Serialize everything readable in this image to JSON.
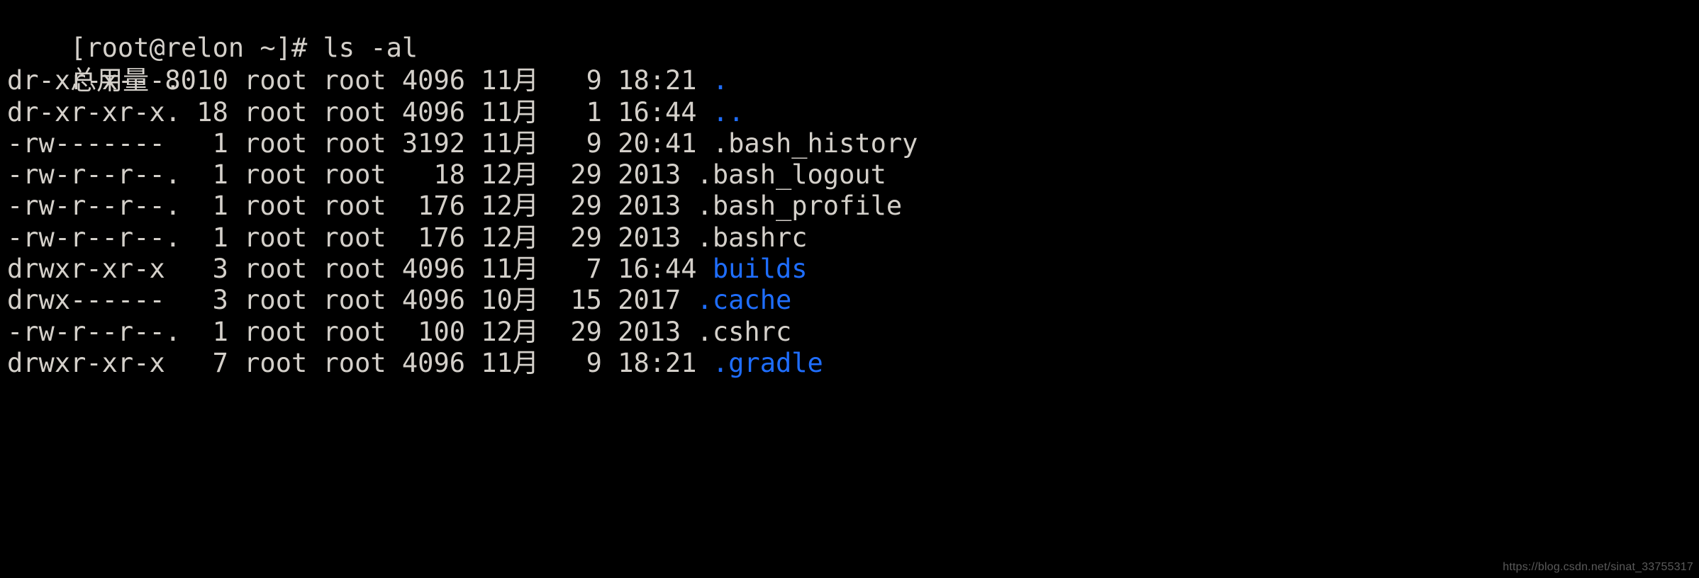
{
  "terminal": {
    "background_color": "#000000",
    "foreground_color": "#d4d0ca",
    "directory_color": "#1f6eff",
    "prompt": {
      "full_line": "[root@relon ~]# ls -al",
      "user_host": "[root@relon ~]#",
      "command": "ls -al"
    },
    "total_line": "总用量 80",
    "columns": [
      "permissions",
      "links",
      "owner",
      "group",
      "size",
      "month",
      "day",
      "time_or_year",
      "name"
    ],
    "entries": [
      {
        "permissions": "dr-xr-x---.",
        "links": "10",
        "owner": "root",
        "group": "root",
        "size": "4096",
        "month": "11月",
        "day": "9",
        "time_or_year": "18:21",
        "name": ".",
        "type": "directory",
        "line": "dr-xr-x---. 10 root root 4096 11月   9 18:21 "
      },
      {
        "permissions": "dr-xr-xr-x.",
        "links": "18",
        "owner": "root",
        "group": "root",
        "size": "4096",
        "month": "11月",
        "day": "1",
        "time_or_year": "16:44",
        "name": "..",
        "type": "directory",
        "line": "dr-xr-xr-x. 18 root root 4096 11月   1 16:44 "
      },
      {
        "permissions": "-rw-------",
        "links": "1",
        "owner": "root",
        "group": "root",
        "size": "3192",
        "month": "11月",
        "day": "9",
        "time_or_year": "20:41",
        "name": ".bash_history",
        "type": "file",
        "line": "-rw-------   1 root root 3192 11月   9 20:41 "
      },
      {
        "permissions": "-rw-r--r--.",
        "links": "1",
        "owner": "root",
        "group": "root",
        "size": "18",
        "month": "12月",
        "day": "29",
        "time_or_year": "2013",
        "name": ".bash_logout",
        "type": "file",
        "line": "-rw-r--r--.  1 root root   18 12月  29 2013 "
      },
      {
        "permissions": "-rw-r--r--.",
        "links": "1",
        "owner": "root",
        "group": "root",
        "size": "176",
        "month": "12月",
        "day": "29",
        "time_or_year": "2013",
        "name": ".bash_profile",
        "type": "file",
        "line": "-rw-r--r--.  1 root root  176 12月  29 2013 "
      },
      {
        "permissions": "-rw-r--r--.",
        "links": "1",
        "owner": "root",
        "group": "root",
        "size": "176",
        "month": "12月",
        "day": "29",
        "time_or_year": "2013",
        "name": ".bashrc",
        "type": "file",
        "line": "-rw-r--r--.  1 root root  176 12月  29 2013 "
      },
      {
        "permissions": "drwxr-xr-x",
        "links": "3",
        "owner": "root",
        "group": "root",
        "size": "4096",
        "month": "11月",
        "day": "7",
        "time_or_year": "16:44",
        "name": "builds",
        "type": "directory",
        "line": "drwxr-xr-x   3 root root 4096 11月   7 16:44 "
      },
      {
        "permissions": "drwx------",
        "links": "3",
        "owner": "root",
        "group": "root",
        "size": "4096",
        "month": "10月",
        "day": "15",
        "time_or_year": "2017",
        "name": ".cache",
        "type": "directory",
        "line": "drwx------   3 root root 4096 10月  15 2017 "
      },
      {
        "permissions": "-rw-r--r--.",
        "links": "1",
        "owner": "root",
        "group": "root",
        "size": "100",
        "month": "12月",
        "day": "29",
        "time_or_year": "2013",
        "name": ".cshrc",
        "type": "file",
        "line": "-rw-r--r--.  1 root root  100 12月  29 2013 "
      },
      {
        "permissions": "drwxr-xr-x",
        "links": "7",
        "owner": "root",
        "group": "root",
        "size": "4096",
        "month": "11月",
        "day": "9",
        "time_or_year": "18:21",
        "name": ".gradle",
        "type": "directory",
        "line": "drwxr-xr-x   7 root root 4096 11月   9 18:21 "
      }
    ]
  },
  "watermark": {
    "text": "https://blog.csdn.net/sinat_33755317"
  }
}
